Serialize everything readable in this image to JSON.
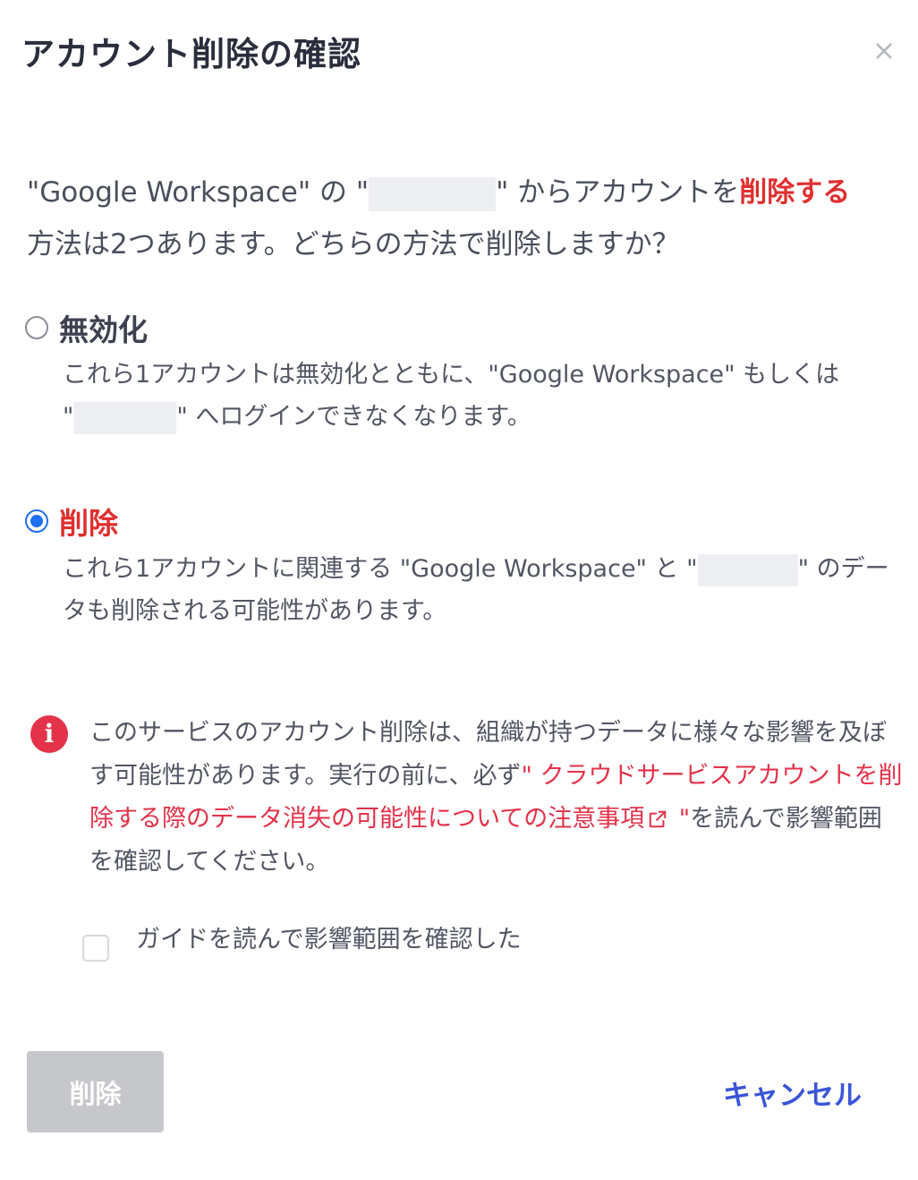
{
  "dialog": {
    "title": "アカウント削除の確認",
    "close_symbol": "×"
  },
  "intro": {
    "part1": "\"Google Workspace\" の \"",
    "part2": "\" からアカウントを",
    "danger": "削除する",
    "part3": "方法は2つあります。どちらの方法で削除しますか？"
  },
  "options": {
    "disable": {
      "label": "無効化",
      "checked": false,
      "desc1": "これら1アカウントは無効化とともに、\"Google Workspace\" もしくは",
      "desc2_quote": "\"",
      "desc2_rest": "\" へログインできなくなります。"
    },
    "delete": {
      "label": "削除",
      "checked": true,
      "desc1": "これら1アカウントに関連する \"Google Workspace\" と \"",
      "desc1_rest": "\" のデー",
      "desc2": "タも削除される可能性があります。"
    }
  },
  "notice": {
    "icon": "i",
    "text1": "このサービスのアカウント削除は、組織が持つデータに様々な影響を及ぼす可能性があります。実行の前に、必ず",
    "link": "\" クラウドサービスアカウントを削除する際のデータ消失の可能性についての注意事項",
    "link_end": " \"",
    "text2": "を読んで影響範囲を確認してください。"
  },
  "confirm": {
    "label": "ガイドを読んで影響範囲を確認した",
    "checked": false
  },
  "buttons": {
    "delete_label": "削除",
    "cancel_label": "キャンセル"
  },
  "colors": {
    "danger": "#e02f2f",
    "link": "#e3324a",
    "primary": "#3a55d8",
    "radio_checked": "#1f6ff5",
    "disabled_button": "#c6c7cb"
  }
}
